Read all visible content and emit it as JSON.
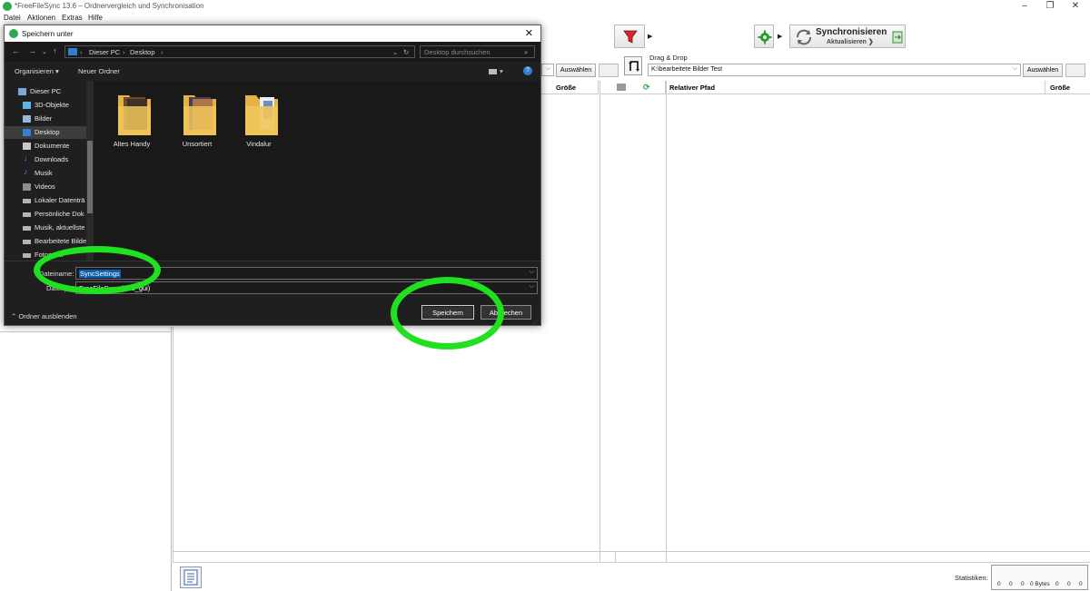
{
  "window": {
    "title": "*FreeFileSync 13.6 – Ordnervergleich und Synchronisation",
    "menu": [
      "Datei",
      "Aktionen",
      "Extras",
      "Hilfe"
    ]
  },
  "toolbar": {
    "sync_title": "Synchronisieren",
    "sync_sub": "Aktualisieren ❯"
  },
  "right_side": {
    "drag_drop": "Drag & Drop",
    "path": "K:\\bearbeitete Bilder Test",
    "browse": "Auswählen"
  },
  "left_side": {
    "browse": "Auswählen"
  },
  "grid": {
    "left_size_header": "Größe",
    "right_path_header": "Relativer Pfad",
    "right_size_header": "Größe"
  },
  "status": {
    "stats_label": "Statistiken:",
    "stats_values": [
      "0",
      "0",
      "0",
      "0 Bytes",
      "0",
      "0",
      "0"
    ]
  },
  "dialog": {
    "title": "Speichern unter",
    "breadcrumb": [
      "Dieser PC",
      "Desktop"
    ],
    "search_placeholder": "Desktop durchsuchen",
    "organize": "Organisieren ▾",
    "new_folder": "Neuer Ordner",
    "sidebar": [
      {
        "label": "Dieser PC",
        "icon": "pc-icon"
      },
      {
        "label": "3D-Objekte",
        "icon": "cube-icon"
      },
      {
        "label": "Bilder",
        "icon": "pictures-icon"
      },
      {
        "label": "Desktop",
        "icon": "desktop-icon",
        "selected": true
      },
      {
        "label": "Dokumente",
        "icon": "documents-icon"
      },
      {
        "label": "Downloads",
        "icon": "download-icon"
      },
      {
        "label": "Musik",
        "icon": "music-icon"
      },
      {
        "label": "Videos",
        "icon": "videos-icon"
      },
      {
        "label": "Lokaler Datenträ",
        "icon": "drive-icon"
      },
      {
        "label": "Persönliche Dok",
        "icon": "drive-icon"
      },
      {
        "label": "Musik, aktuellste",
        "icon": "drive-icon"
      },
      {
        "label": "Bearbeitete Bilde",
        "icon": "drive-icon"
      },
      {
        "label": "Fotoarchi",
        "icon": "drive-icon"
      }
    ],
    "folders": [
      "Altes Handy",
      "Unsortiert",
      "Vindalur"
    ],
    "filename_label": "Dateiname:",
    "filename_value": "SyncSettings",
    "filetype_label": "Dateityp:",
    "filetype_value": "FreeFileSync (*.ffs_gui)",
    "hide_folders": "Ordner ausblenden",
    "save": "Speichern",
    "cancel": "Abbrechen"
  },
  "colors": {
    "highlight_ring": "#1fe11f",
    "dialog_bg": "#1f1f1f",
    "selection": "#0a5fb3",
    "folder": "#f0c75a"
  }
}
